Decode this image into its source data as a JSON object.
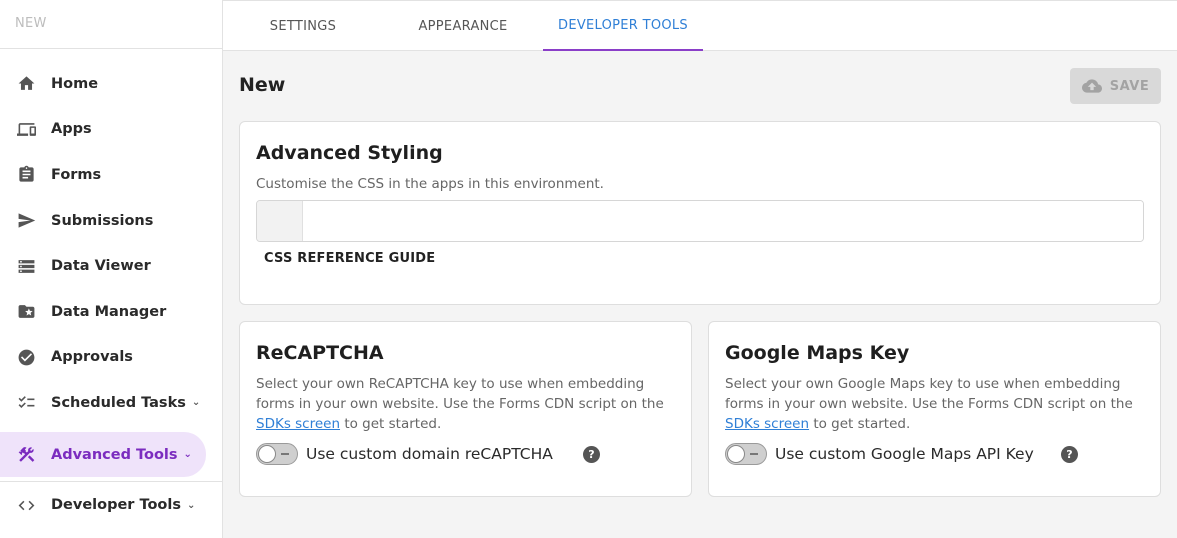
{
  "sidebar": {
    "env_label": "NEW",
    "items": [
      {
        "label": "Home"
      },
      {
        "label": "Apps"
      },
      {
        "label": "Forms"
      },
      {
        "label": "Submissions"
      },
      {
        "label": "Data Viewer"
      },
      {
        "label": "Data Manager"
      },
      {
        "label": "Approvals"
      },
      {
        "label": "Scheduled Tasks"
      },
      {
        "label": "Advanced Tools"
      },
      {
        "label": "Developer Tools"
      }
    ]
  },
  "tabs": [
    "SETTINGS",
    "APPEARANCE",
    "DEVELOPER TOOLS"
  ],
  "page": {
    "title": "New",
    "save_label": "SAVE"
  },
  "advanced_styling": {
    "title": "Advanced Styling",
    "description": "Customise the CSS in the apps in this environment.",
    "ref_link": "CSS REFERENCE GUIDE"
  },
  "recaptcha": {
    "title": "ReCAPTCHA",
    "desc_before": "Select your own ReCAPTCHA key to use when embedding forms in your own website. Use the Forms CDN script on the ",
    "link": "SDKs screen",
    "desc_after": " to get started.",
    "toggle_label": "Use custom domain reCAPTCHA",
    "toggle_on": false
  },
  "google_maps": {
    "title": "Google Maps Key",
    "desc_before": "Select your own Google Maps key to use when embedding forms in your own website. Use the Forms CDN script on the ",
    "link": "SDKs screen",
    "desc_after": " to get started.",
    "toggle_label": "Use custom Google Maps API Key",
    "toggle_on": false
  },
  "colors": {
    "accent": "#7b2cbf",
    "link": "#2f7fd6",
    "active_bg": "#efe3fa"
  }
}
